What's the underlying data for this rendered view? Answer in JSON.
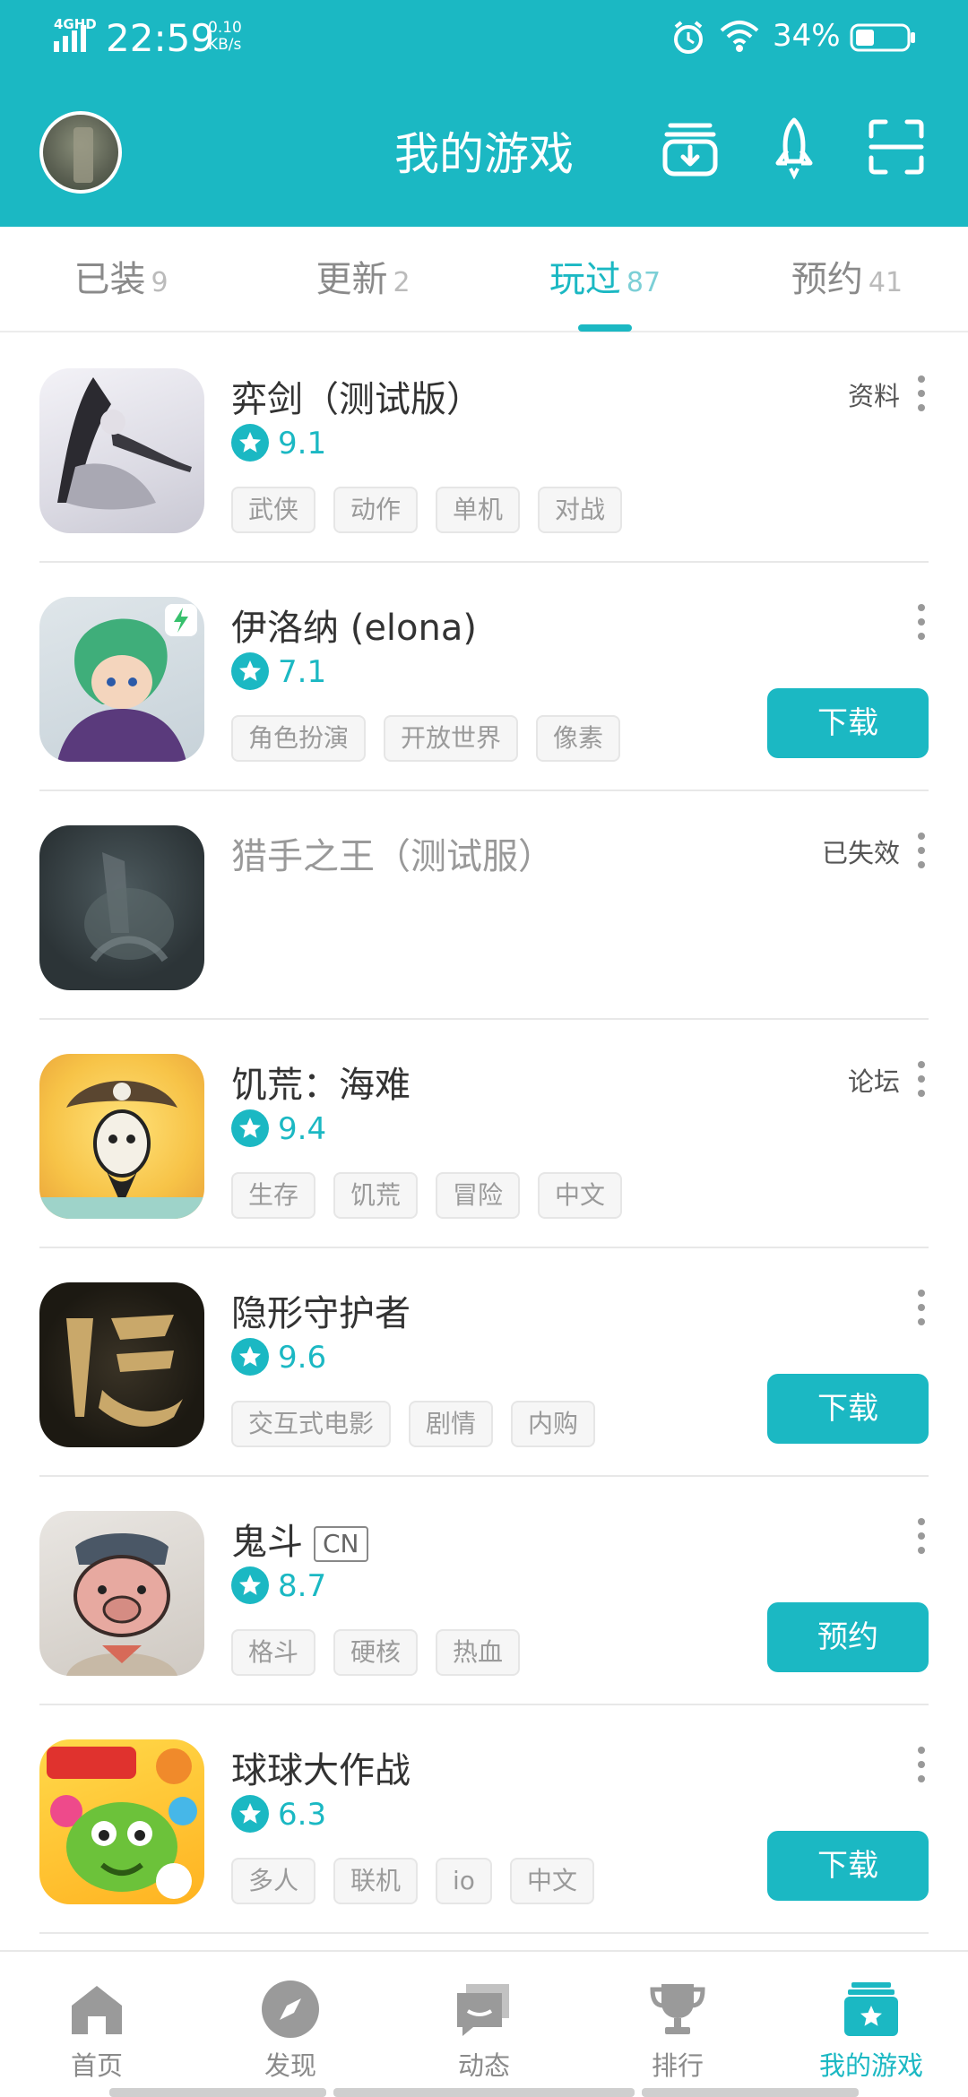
{
  "status_bar": {
    "network": "4GHD",
    "time": "22:59",
    "speed_value": "0.10",
    "speed_unit": "KB/s",
    "battery": "34%"
  },
  "header": {
    "title": "我的游戏",
    "icons": [
      "download-box-icon",
      "rocket-icon",
      "scan-icon"
    ]
  },
  "tabs": [
    {
      "label": "已装",
      "count": "9"
    },
    {
      "label": "更新",
      "count": "2"
    },
    {
      "label": "玩过",
      "count": "87",
      "active": true
    },
    {
      "label": "预约",
      "count": "41"
    }
  ],
  "games": [
    {
      "name": "弈剑（测试版）",
      "rating": "9.1",
      "tags": [
        "武侠",
        "动作",
        "单机",
        "对战"
      ],
      "side_link": "资料",
      "button": ""
    },
    {
      "name": "伊洛纳 (elona)",
      "rating": "7.1",
      "tags": [
        "角色扮演",
        "开放世界",
        "像素"
      ],
      "side_link": "",
      "button": "下载"
    },
    {
      "name": "猎手之王（测试服）",
      "rating": "",
      "tags": [],
      "side_link": "已失效",
      "button": ""
    },
    {
      "name": "饥荒：海难",
      "rating": "9.4",
      "tags": [
        "生存",
        "饥荒",
        "冒险",
        "中文"
      ],
      "side_link": "论坛",
      "button": ""
    },
    {
      "name": "隐形守护者",
      "rating": "9.6",
      "tags": [
        "交互式电影",
        "剧情",
        "内购"
      ],
      "side_link": "",
      "button": "下载"
    },
    {
      "name": "鬼斗",
      "badge": "CN",
      "rating": "8.7",
      "tags": [
        "格斗",
        "硬核",
        "热血"
      ],
      "side_link": "",
      "button": "预约"
    },
    {
      "name": "球球大作战",
      "rating": "6.3",
      "tags": [
        "多人",
        "联机",
        "io",
        "中文"
      ],
      "side_link": "",
      "button": "下载"
    }
  ],
  "bottom_nav": [
    {
      "label": "首页",
      "icon": "home-icon"
    },
    {
      "label": "发现",
      "icon": "compass-icon"
    },
    {
      "label": "动态",
      "icon": "chat-icon"
    },
    {
      "label": "排行",
      "icon": "trophy-icon"
    },
    {
      "label": "我的游戏",
      "icon": "my-games-icon",
      "active": true
    }
  ],
  "colors": {
    "accent": "#1bb8c3"
  }
}
